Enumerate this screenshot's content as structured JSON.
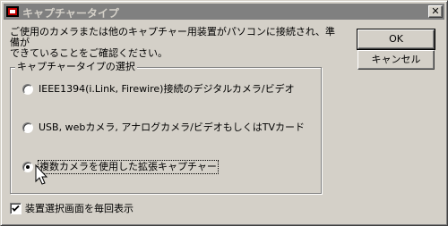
{
  "window": {
    "title": "キャプチャータイプ",
    "close_label": "✕"
  },
  "description": "ご使用のカメラまたは他のキャプチャー用装置がパソコンに接続され、準備が\nできていることをご確認ください。",
  "buttons": {
    "ok": "OK",
    "cancel": "キャンセル"
  },
  "group": {
    "legend": "キャプチャータイプの選択",
    "options": [
      {
        "label": "IEEE1394(i.Link, Firewire)接続のデジタルカメラ/ビデオ",
        "selected": false
      },
      {
        "label": "USB, webカメラ, アナログカメラ/ビデオもしくはTVカード",
        "selected": false
      },
      {
        "label": "複数カメラを使用した拡張キャプチャー",
        "selected": true
      }
    ]
  },
  "checkbox": {
    "label": "装置選択画面を毎回表示",
    "checked": true
  },
  "colors": {
    "face": "#d4d0c8",
    "inactive_title": "#808080"
  },
  "icons": {
    "app": "app-icon",
    "close": "close-icon",
    "cursor": "mouse-pointer-icon"
  }
}
